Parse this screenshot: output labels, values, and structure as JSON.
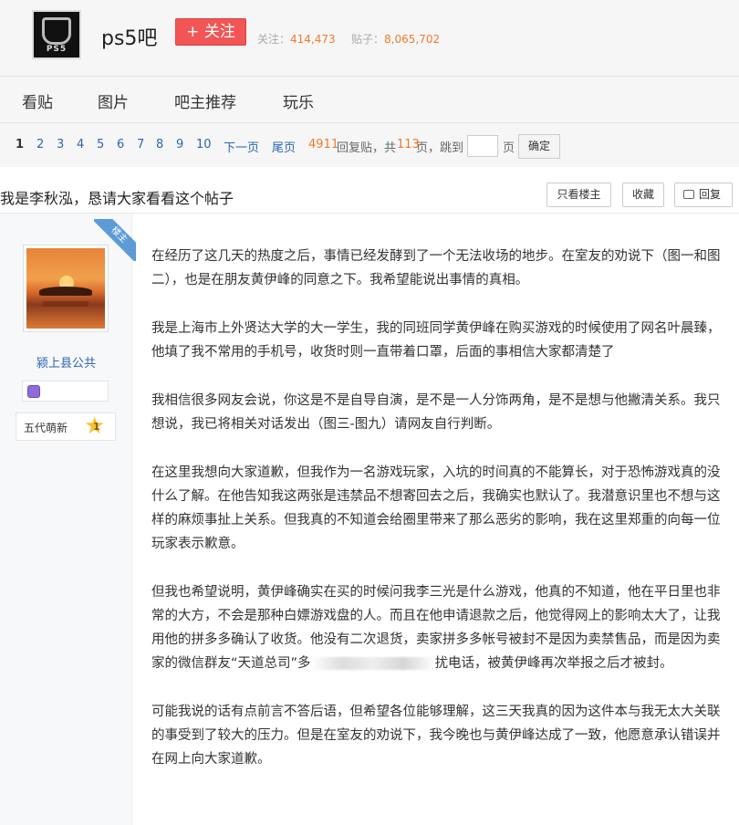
{
  "header": {
    "logo_text": "PS5",
    "forum_name": "ps5吧",
    "follow_label": "+ 关注",
    "follow_count_label": "关注：",
    "follow_count": "414,473",
    "post_count_label": "贴子：",
    "post_count": "8,065,702"
  },
  "nav": {
    "items": [
      "看贴",
      "图片",
      "吧主推荐",
      "玩乐"
    ]
  },
  "pager": {
    "current": "1",
    "pages": [
      "2",
      "3",
      "4",
      "5",
      "6",
      "7",
      "8",
      "9",
      "10"
    ],
    "next": "下一页",
    "last": "尾页",
    "reply_count": "4911",
    "reply_label": "回复贴，共",
    "total_pages": "113",
    "pages_unit": "页，跳到",
    "page_suffix": "页",
    "confirm": "确定"
  },
  "thread": {
    "title": "我是李秋泓，恳请大家看看这个帖子",
    "only_op": "只看楼主",
    "favorite": "收藏",
    "reply": "回复"
  },
  "author": {
    "badge": "楼主",
    "username": "颍上县公共",
    "level_title": "五代萌新",
    "level": "1"
  },
  "post": {
    "p1": "在经历了这几天的热度之后，事情已经发酵到了一个无法收场的地步。在室友的劝说下（图一和图二），也是在朋友黄伊峰的同意之下。我希望能说出事情的真相。",
    "p2": "我是上海市上外贤达大学的大一学生，我的同班同学黄伊峰在购买游戏的时候使用了网名叶晨臻，他填了我不常用的手机号，收货时则一直带着口罩，后面的事相信大家都清楚了",
    "p3": "我相信很多网友会说，你这是不是自导自演，是不是一人分饰两角，是不是想与他撇清关系。我只想说，我已将相关对话发出（图三-图九）请网友自行判断。",
    "p4": "在这里我想向大家道歉，但我作为一名游戏玩家，入坑的时间真的不能算长，对于恐怖游戏真的没什么了解。在他告知我这两张是违禁品不想寄回去之后，我确实也默认了。我潜意识里也不想与这样的麻烦事扯上关系。但我真的不知道会给圈里带来了那么恶劣的影响，我在这里郑重的向每一位玩家表示歉意。",
    "p5a": "但我也希望说明，黄伊峰确实在买的时候问我李三光是什么游戏，他真的不知道，他在平日里也非常的大方，不会是那种白嫖游戏盘的人。而且在他申请退款之后，他觉得网上的影响太大了，让我用他的拼多多确认了收货。他没有二次退货，卖家拼多多帐号被封不是因为卖禁售品，而是因为卖家的微信群友“天道总司”多",
    "p5b": "扰电话，被黄伊峰再次举报之后才被封。",
    "p6": "可能我说的话有点前言不答后语，但希望各位能够理解，这三天我真的因为这件本与我无太大关联的事受到了较大的压力。但是在室友的劝说下，我今晚也与黄伊峰达成了一致，他愿意承认错误并在网上向大家道歉。"
  }
}
